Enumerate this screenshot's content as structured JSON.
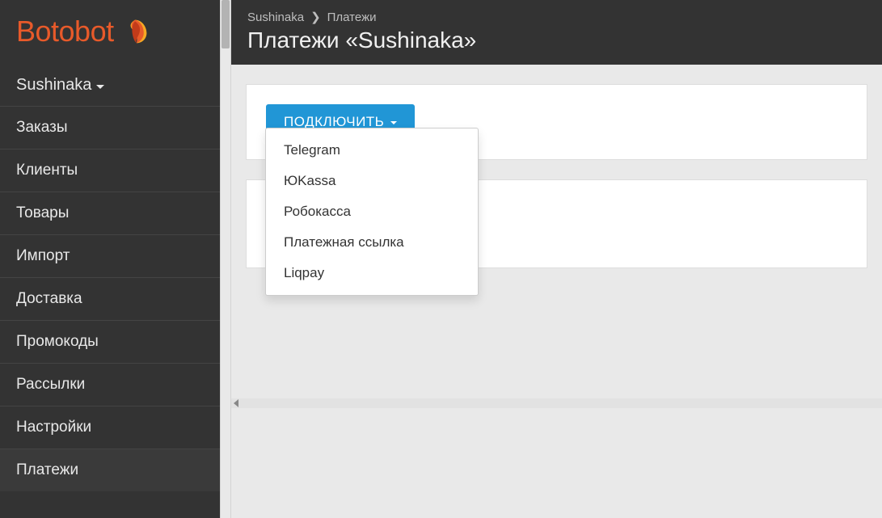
{
  "brand": "Botobot",
  "account": {
    "name": "Sushinaka"
  },
  "sidebar": {
    "items": [
      {
        "label": "Заказы"
      },
      {
        "label": "Клиенты"
      },
      {
        "label": "Товары"
      },
      {
        "label": "Импорт"
      },
      {
        "label": "Доставка"
      },
      {
        "label": "Промокоды"
      },
      {
        "label": "Рассылки"
      },
      {
        "label": "Настройки"
      },
      {
        "label": "Платежи"
      }
    ]
  },
  "breadcrumb": {
    "root": "Sushinaka",
    "current": "Платежи"
  },
  "page_title": "Платежи «Sushinaka»",
  "connect_button": "ПОДКЛЮЧИТЬ",
  "dropdown": {
    "items": [
      "Telegram",
      "ЮKassa",
      "Робокасса",
      "Платежная ссылка",
      "Liqpay"
    ]
  }
}
